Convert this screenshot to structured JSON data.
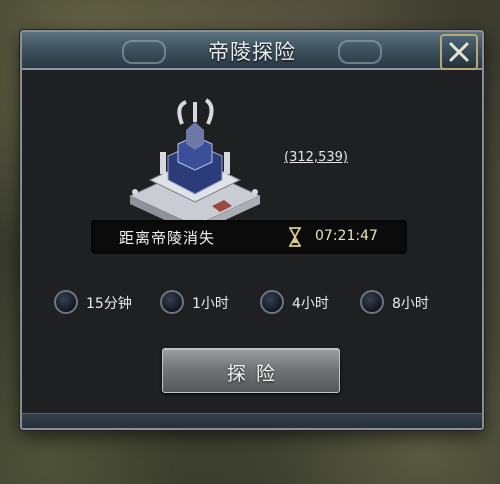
{
  "dialog": {
    "title": "帝陵探险",
    "close_icon": "close-x-icon"
  },
  "mausoleum": {
    "icon": "mausoleum-building-icon",
    "coordinates": "(312,539)"
  },
  "timer": {
    "label": "距离帝陵消失",
    "icon": "hourglass-icon",
    "value": "07:21:47"
  },
  "durations": [
    {
      "label": "15分钟"
    },
    {
      "label": "1小时"
    },
    {
      "label": "4小时"
    },
    {
      "label": "8小时"
    }
  ],
  "explore_button": {
    "label": "探险"
  },
  "colors": {
    "title_bar": "#3f5360",
    "panel": "#1f2022",
    "timer_text": "#e9e3b8",
    "close_border": "#b9a774"
  }
}
